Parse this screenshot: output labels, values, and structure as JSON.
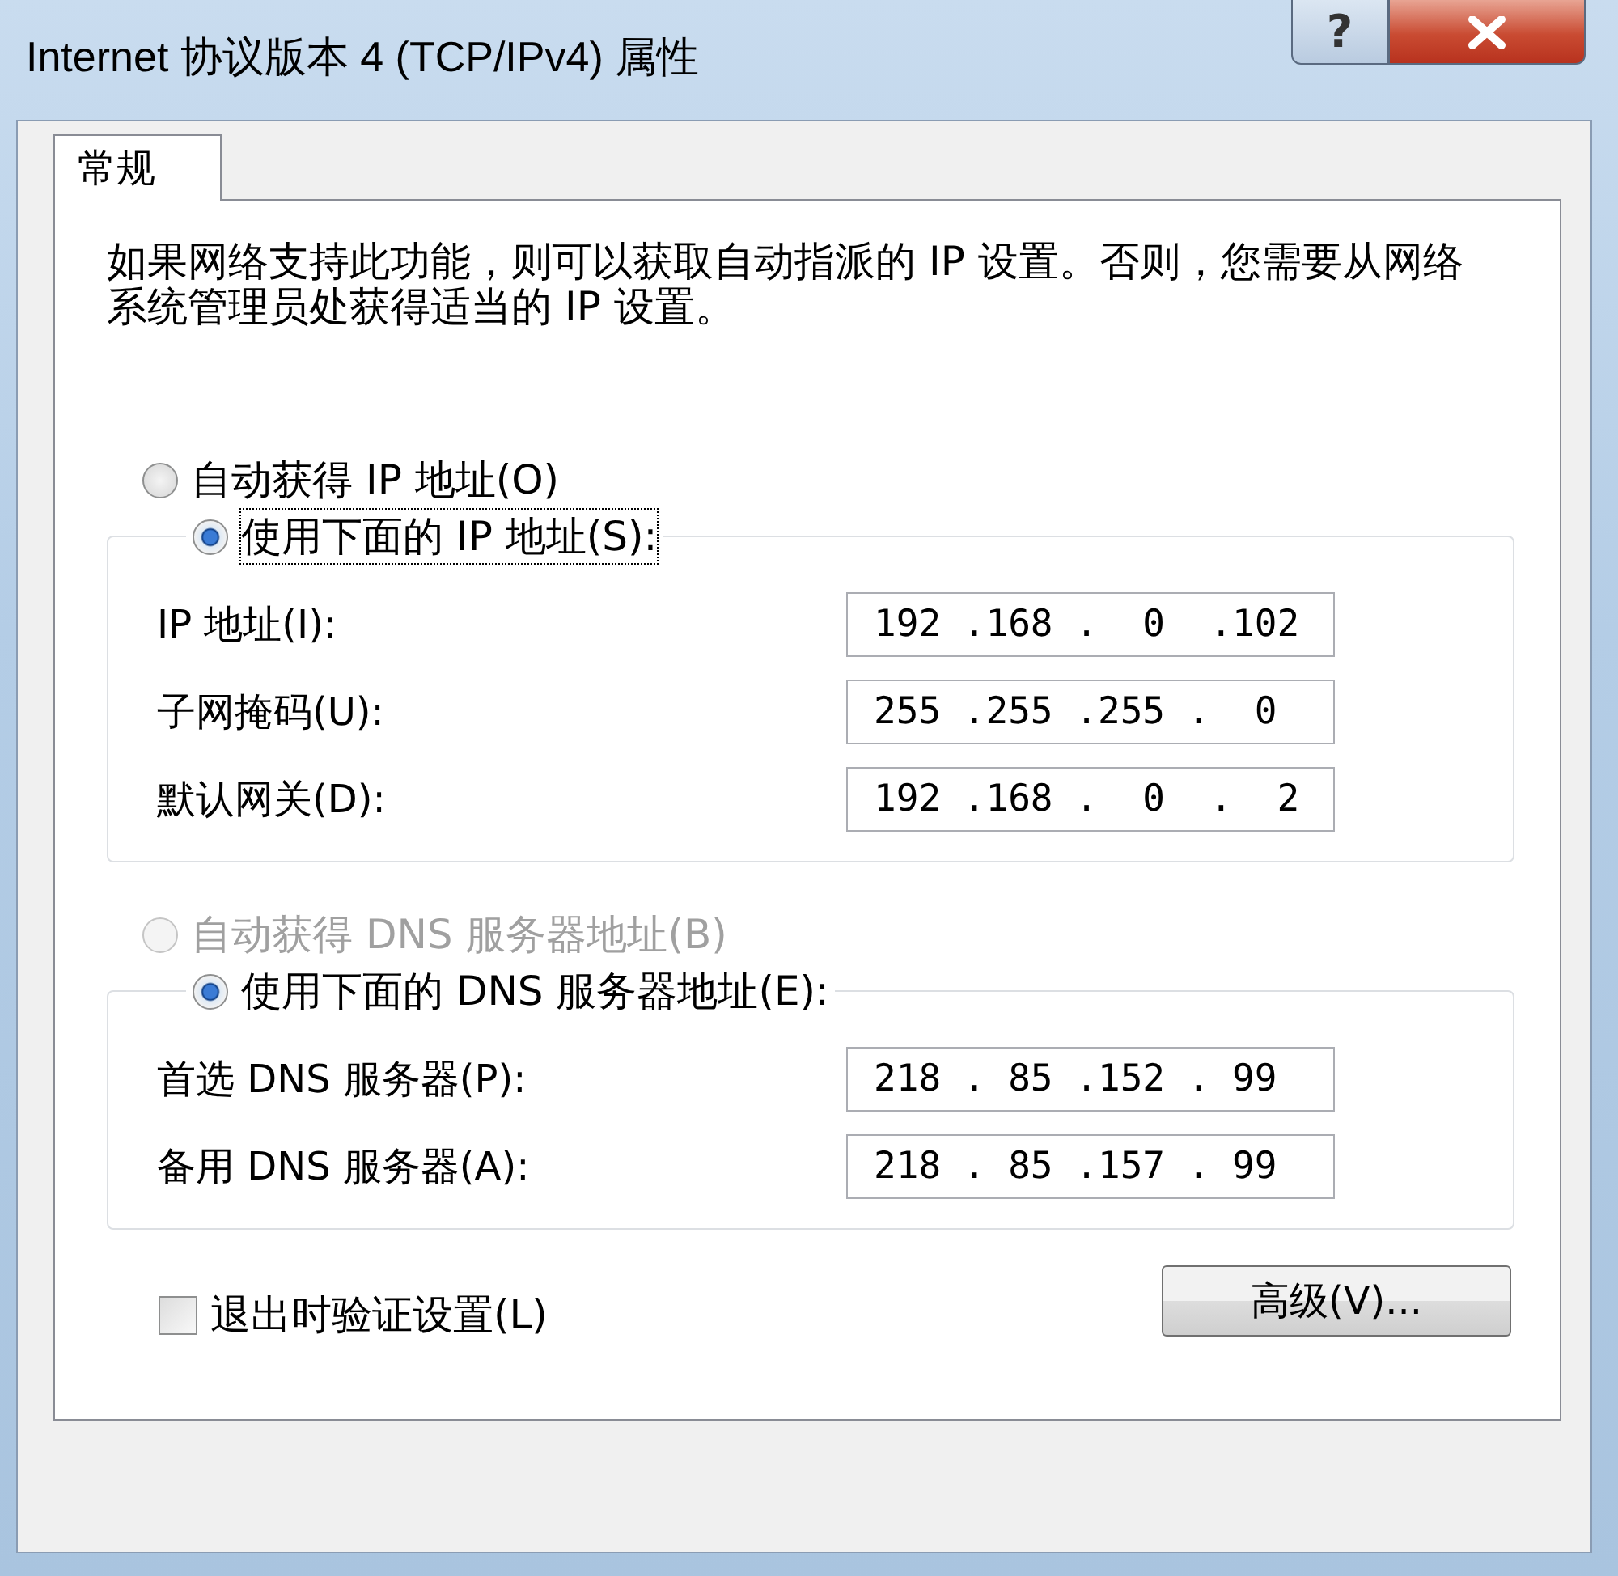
{
  "window": {
    "title": "Internet 协议版本 4 (TCP/IPv4) 属性",
    "help_button": "?"
  },
  "tabs": [
    {
      "label": "常规",
      "selected": true
    }
  ],
  "description": "如果网络支持此功能，则可以获取自动指派的 IP 设置。否则，您需要从网络系统管理员处获得适当的 IP 设置。",
  "groups": [
    {
      "auto_option": {
        "label": "自动获得 IP 地址(O)",
        "selected": false,
        "disabled": false
      },
      "manual_option": {
        "label": "使用下面的 IP 地址(S):",
        "selected": true,
        "disabled": false
      },
      "fields": [
        {
          "label": "IP 地址(I):",
          "value": "192 .168 .  0  .102"
        },
        {
          "label": "子网掩码(U):",
          "value": "255 .255 .255 .  0"
        },
        {
          "label": "默认网关(D):",
          "value": "192 .168 .  0  .  2"
        }
      ]
    },
    {
      "auto_option": {
        "label": "自动获得 DNS 服务器地址(B)",
        "selected": false,
        "disabled": true
      },
      "manual_option": {
        "label": "使用下面的 DNS 服务器地址(E):",
        "selected": true,
        "disabled": false
      },
      "fields": [
        {
          "label": "首选 DNS 服务器(P):",
          "value": "218 . 85 .152 . 99"
        },
        {
          "label": "备用 DNS 服务器(A):",
          "value": "218 . 85 .157 . 99"
        }
      ]
    }
  ],
  "validate_on_exit": {
    "label": "退出时验证设置(L)",
    "checked": false
  },
  "advanced_button": "高级(V)..."
}
